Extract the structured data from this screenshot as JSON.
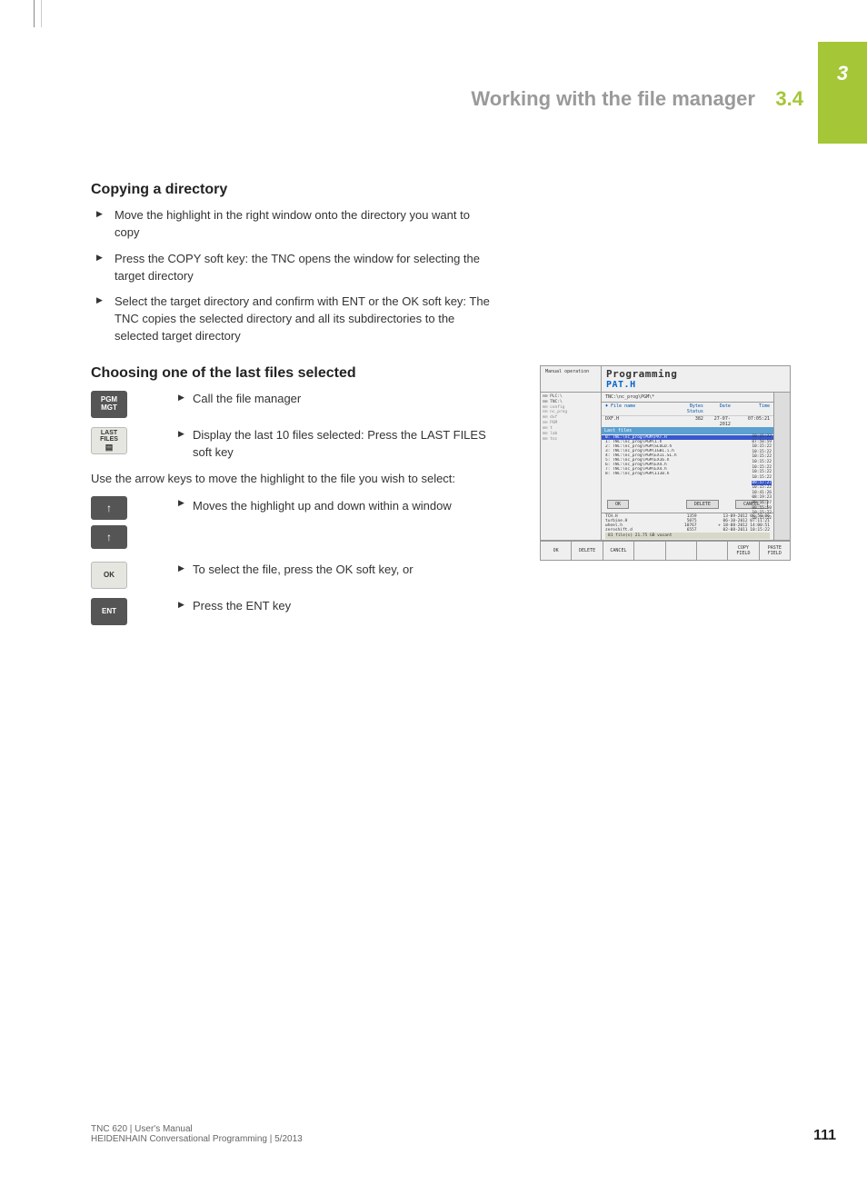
{
  "chapter_tab": "3",
  "header": {
    "title": "Working with the file manager",
    "section": "3.4"
  },
  "s1": {
    "heading": "Copying a directory",
    "items": [
      "Move the highlight in the right window onto the directory you want to copy",
      "Press the COPY soft key: the TNC opens the window for selecting the target directory",
      "Select the target directory and confirm with ENT or the OK soft key: The TNC copies the selected directory and all its subdirectories to the selected target directory"
    ]
  },
  "s2": {
    "heading": "Choosing one of the last files selected",
    "pgm_key": "PGM\nMGT",
    "pgm_text": "Call the file manager",
    "last_key": "LAST\nFILES",
    "last_text": "Display the last 10 files selected: Press the LAST FILES soft key",
    "para": "Use the arrow keys to move the highlight to the file you wish to select:",
    "arrows_text": "Moves the highlight up and down within a window",
    "ok_key": "OK",
    "ok_text": "To select the file, press the OK soft key, or",
    "ent_key": "ENT",
    "ent_text": "Press the ENT key"
  },
  "shot": {
    "mode": "Manual operation",
    "title": "Programming",
    "subtitle": "PAT.H",
    "path": "TNC:\\nc_prog\\PGM\\*",
    "tree": [
      "⊟⊡ PLC:\\",
      "⊟⊡ TNC:\\",
      " ⊞⊡ config",
      " ⊟⊡ nc_prog",
      "  ⊞⊡ dxf",
      "  ⊡⊡ PGM",
      " ⊞⊡ t",
      " ⊞⊡ lab",
      " ⊞⊡ tnc"
    ],
    "cols": [
      "♦ File name",
      "Bytes Status",
      "Date",
      "Time"
    ],
    "rowhead": {
      "name": "DXF.H",
      "bytes": "382",
      "date": "27-07-2012",
      "time": "07:05:21"
    },
    "lastfiles_label": "Last files",
    "files": [
      "0: TNC:\\nc_prog\\PGM\\PAT.H",
      "1: TNC:\\nc_prog\\PGM\\1.h",
      "2: TNC:\\nc_prog\\PGM\\SLOLD.h",
      "3: TNC:\\nc_prog\\PGM\\1GB1.i.h",
      "4: TNC:\\nc_prog\\PGM\\EX11.SL.h",
      "5: TNC:\\nc_prog\\PGM\\EX16.h",
      "6: TNC:\\nc_prog\\PGM\\EX4.h",
      "7: TNC:\\nc_prog\\PGM\\EX4.h",
      "8: TNC:\\nc_prog\\PGM\\1110.h"
    ],
    "dates": [
      "10:15:22",
      "07:58:59",
      "10:15:22",
      "10:15:22",
      "10:15:22",
      "10:15:22",
      "10:15:22",
      "10:15:22",
      "10:15:22",
      "09:57:27",
      "10:15:22",
      "10:41:26",
      "08:19:23",
      "08:16:27",
      "08:55:50",
      "10:15:22",
      "10:15:22"
    ],
    "dialog_btns": [
      "OK",
      "DELETE",
      "CANCEL"
    ],
    "stats": [
      {
        "n": "TCH.H",
        "b": "1359",
        "d": "13-09-2012 08:59:06"
      },
      {
        "n": "turbine.H",
        "b": "5075",
        "d": "06-10-2012 07:11:21"
      },
      {
        "n": "wheel.h",
        "b": "10767",
        "d": "+ 18-08-2012 14:00:51"
      },
      {
        "n": "zeroshift.d",
        "b": "6557",
        "d": "02-08-2011 10:15:22"
      }
    ],
    "summary": "81  file(s)  21.75 GB vacant",
    "softkeys": [
      "OK",
      "DELETE",
      "CANCEL",
      "",
      "",
      "",
      "COPY\nFIELD",
      "PASTE\nFIELD"
    ]
  },
  "footer": {
    "line1": "TNC 620 | User's Manual",
    "line2": "HEIDENHAIN Conversational Programming | 5/2013",
    "page": "111"
  }
}
